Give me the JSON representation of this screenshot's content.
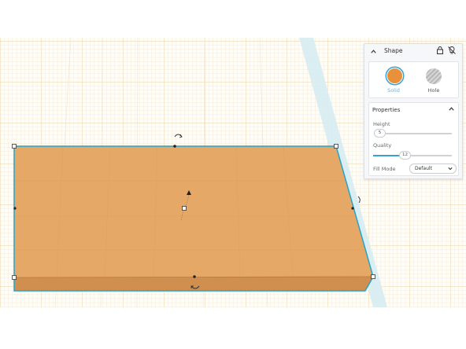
{
  "colors": {
    "shape_fill": "#e6a867",
    "shape_edge": "#c98e52",
    "selection_outline": "#25a4c9",
    "grid_line": "#dfe9f0",
    "grid_major": "#f1d9b0",
    "accent": "#3a9fd1",
    "solid_swatch": "#e8913a"
  },
  "shape_panel": {
    "title": "Shape",
    "icons": {
      "collapse": "chevron-up-icon",
      "lock": "lock-icon",
      "visibility": "lightbulb-off-icon"
    },
    "options": [
      {
        "label": "Solid",
        "selected": true
      },
      {
        "label": "Hole",
        "selected": false
      }
    ]
  },
  "properties": {
    "title": "Properties",
    "height": {
      "label": "Height",
      "value": "5"
    },
    "quality": {
      "label": "Quality",
      "value": "12"
    },
    "fill_mode": {
      "label": "Fill Mode",
      "value": "Default"
    }
  }
}
